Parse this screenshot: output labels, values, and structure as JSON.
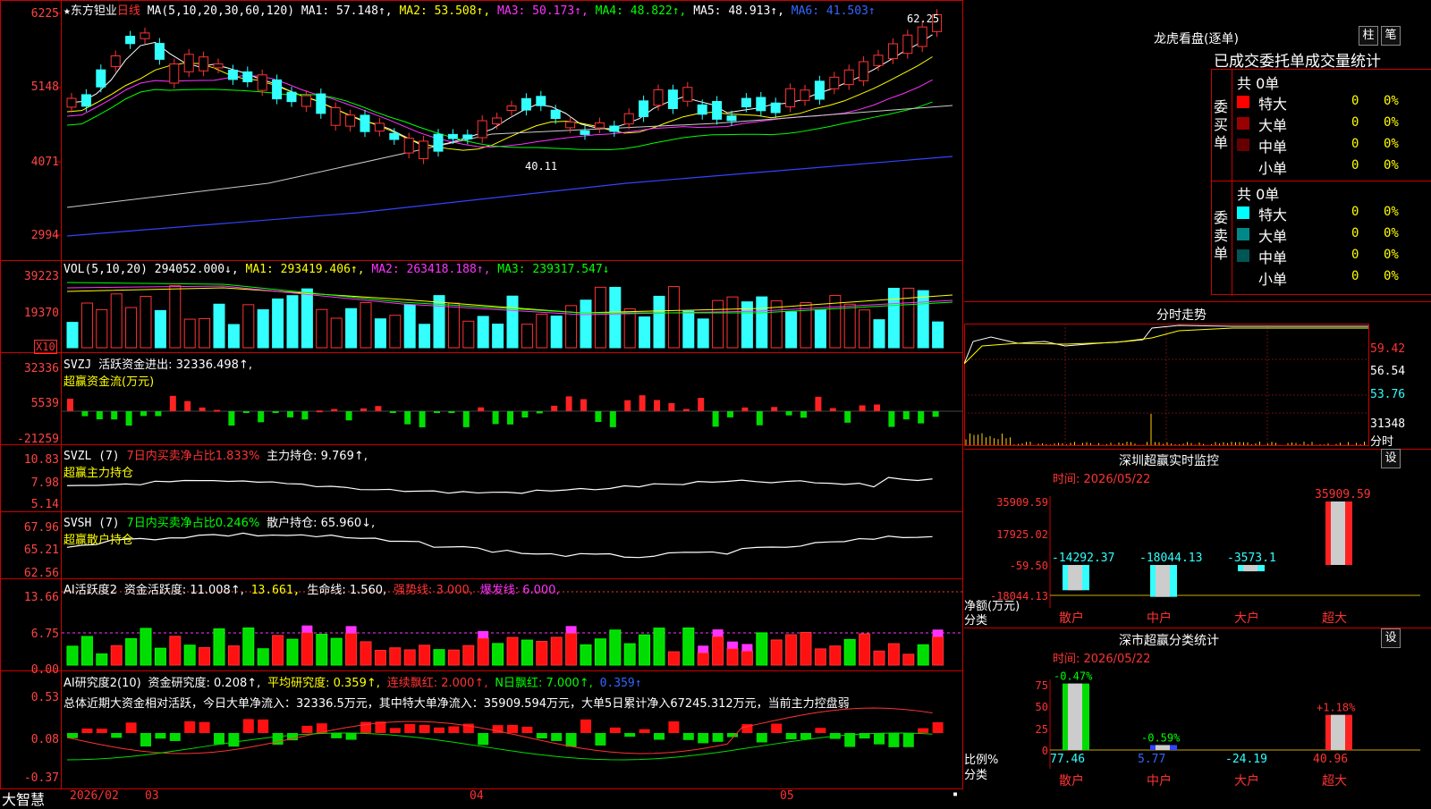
{
  "stock": {
    "star": "★",
    "name": "东方钽业",
    "period": "日线",
    "ma_label": "MA(5,10,20,30,60,120)",
    "ma1": "MA1: 57.148↑,",
    "ma2": "MA2: 53.508↑,",
    "ma3": "MA3: 50.173↑,",
    "ma4": "MA4: 48.822↑,",
    "ma5": "MA5: 48.913↑,",
    "ma6": "MA6: 41.503↑"
  },
  "price_axis": [
    "6225",
    "5148",
    "4071",
    "2994"
  ],
  "price_marks": {
    "high": "62.25",
    "low": "40.11"
  },
  "vol": {
    "label": "VOL(5,10,20)",
    "value": "294052.000↓,",
    "ma1": "MA1: 293419.406↑,",
    "ma2": "MA2: 263418.188↑,",
    "ma3": "MA3: 239317.547↓",
    "axis": [
      "39223",
      "19370"
    ],
    "unit": "X10"
  },
  "svzj": {
    "l1a": "SVZJ",
    "l1b": "活跃资金进出: 32336.498↑,",
    "l2": "超赢资金流(万元)",
    "axis": [
      "32336",
      "5539",
      "-21259"
    ]
  },
  "svzl": {
    "a": "SVZL (7)",
    "b": "7日内买卖净占比1.833%",
    "c": "主力持仓: 9.769↑,",
    "l2": "超赢主力持仓",
    "axis": [
      "10.83",
      "7.98",
      "5.14"
    ]
  },
  "svsh": {
    "a": "SVSH (7)",
    "b": "7日内买卖净占比0.246%",
    "c": "散户持仓: 65.960↓,",
    "l2": "超赢散户持仓",
    "axis": [
      "67.96",
      "65.21",
      "62.56"
    ]
  },
  "ai1": {
    "a": "AI活跃度2",
    "b": "资金活跃度: 11.008↑,",
    "c": "13.661,",
    "d": "生命线: 1.560,",
    "e": "强势线: 3.000,",
    "f": "爆发线: 6.000,",
    "axis": [
      "13.66",
      "6.75",
      "0.00"
    ]
  },
  "ai2": {
    "a": "AI研究度2(10)",
    "b": "资金研究度: 0.208↑,",
    "c": "平均研究度: 0.359↑,",
    "d": "连续飘红: 2.000↑,",
    "e": "N日飘红: 7.000↑,",
    "f": "0.359↑",
    "summary": "总体近期大资金相对活跃，今日大单净流入：32336.5万元，其中特大单净流入：35909.594万元，大单5日累计净入67245.312万元，当前主力控盘弱",
    "axis": [
      "0.53",
      "0.08",
      "-0.37"
    ]
  },
  "xaxis": {
    "brand": "大智慧",
    "m1": "2026/02",
    "m2": "03",
    "m3": "04",
    "m4": "05"
  },
  "right": {
    "title": "龙虎看盘(逐单)",
    "btn_zhu": "柱",
    "btn_bi": "笔",
    "header": "已成交委托单成交量统计",
    "buy_label": "委买单",
    "sell_label": "委卖单",
    "count": "共 0单",
    "rows": [
      {
        "n": "特大",
        "v": "0",
        "p": "0%"
      },
      {
        "n": "大单",
        "v": "0",
        "p": "0%"
      },
      {
        "n": "中单",
        "v": "0",
        "p": "0%"
      },
      {
        "n": "小单",
        "v": "0",
        "p": "0%"
      }
    ],
    "colors": {
      "buy": [
        "#ff0000",
        "#990000",
        "#660000"
      ],
      "sell": [
        "#00ffff",
        "#008888",
        "#005555"
      ]
    },
    "intraday_title": "分时走势",
    "intraday_axis": [
      "59.42",
      "56.54",
      "53.76",
      "31348"
    ],
    "intraday_unit": "分时",
    "sz_title": "深圳超赢实时监控",
    "sz_time": "时间: 2026/05/22",
    "btn_set": "设",
    "sz_axis": [
      "35909.59",
      "17925.02",
      "-59.50",
      "-18044.13"
    ],
    "sz_ylab": "净额(万元)",
    "sz_xlab": "分类",
    "sz_vals": [
      "-14292.37",
      "-18044.13",
      "-3573.1",
      "35909.59"
    ],
    "cats": [
      "散户",
      "中户",
      "大户",
      "超大"
    ],
    "sc_title": "深市超赢分类统计",
    "sc_time": "时间: 2026/05/22",
    "sc_axis": [
      "75",
      "50",
      "25",
      "0"
    ],
    "sc_ylab": "比例%",
    "sc_xlab": "分类",
    "sc_top": [
      "-0.47%",
      "-0.59%",
      "+1.18%"
    ],
    "sc_vals": [
      "77.46",
      "5.77",
      "-24.19",
      "40.96"
    ]
  }
}
